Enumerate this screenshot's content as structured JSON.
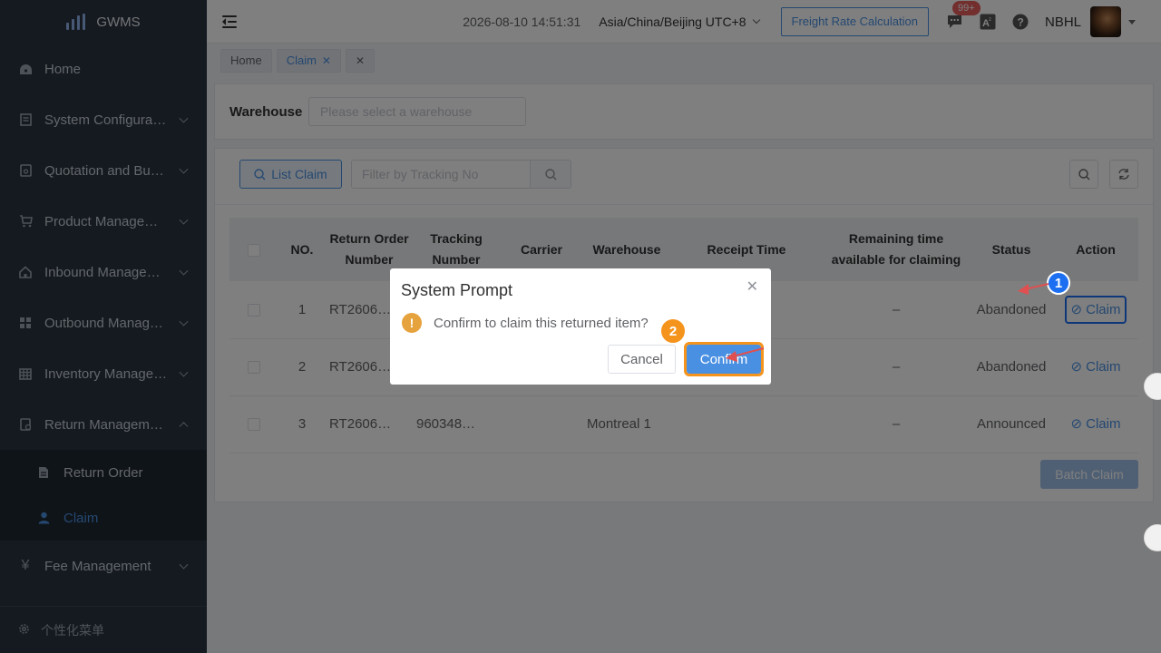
{
  "app": {
    "name": "GWMS"
  },
  "sidebar": {
    "items": [
      {
        "label": "Home",
        "icon": "dashboard-icon"
      },
      {
        "label": "System Configuration",
        "icon": "document-icon"
      },
      {
        "label": "Quotation and Business",
        "icon": "quote-icon"
      },
      {
        "label": "Product Management",
        "icon": "cart-icon"
      },
      {
        "label": "Inbound Management",
        "icon": "home-icon"
      },
      {
        "label": "Outbound Management",
        "icon": "grid-icon"
      },
      {
        "label": "Inventory Management",
        "icon": "table-icon"
      },
      {
        "label": "Return Management",
        "icon": "return-icon"
      },
      {
        "label": "Fee Management",
        "icon": "yen-icon"
      }
    ],
    "sub_items": [
      {
        "label": "Return Order",
        "icon": "file-icon"
      },
      {
        "label": "Claim",
        "icon": "user-icon"
      }
    ],
    "footer": "个性化菜单"
  },
  "header": {
    "datetime": "2026-08-10 14:51:31",
    "timezone": "Asia/China/Beijing UTC+8",
    "freight_button": "Freight Rate Calculation",
    "badge": "99+",
    "user": "NBHL"
  },
  "tabs": [
    {
      "label": "Home"
    },
    {
      "label": "Claim"
    }
  ],
  "filters": {
    "warehouse_label": "Warehouse",
    "warehouse_placeholder": "Please select a warehouse",
    "list_button": "List Claim",
    "tracking_placeholder": "Filter by Tracking No"
  },
  "table": {
    "headers": [
      "NO.",
      "Return Order Number",
      "Tracking Number",
      "Carrier",
      "Warehouse",
      "Receipt Time",
      "Remaining time available for claiming",
      "Status",
      "Action"
    ],
    "rows": [
      {
        "no": "1",
        "return_order": "RT2606…",
        "tracking": "",
        "carrier": "",
        "warehouse": "",
        "receipt": "",
        "remaining": "–",
        "status": "Abandoned",
        "action": "Claim"
      },
      {
        "no": "2",
        "return_order": "RT2606…",
        "tracking": "",
        "carrier": "",
        "warehouse": "",
        "receipt": "",
        "remaining": "–",
        "status": "Abandoned",
        "action": "Claim"
      },
      {
        "no": "3",
        "return_order": "RT2606…",
        "tracking": "960348…",
        "carrier": "",
        "warehouse": "Montreal 1",
        "receipt": "",
        "remaining": "–",
        "status": "Announced",
        "action": "Claim"
      }
    ],
    "batch_button": "Batch Claim"
  },
  "dialog": {
    "title": "System Prompt",
    "message": "Confirm to claim this returned item?",
    "cancel": "Cancel",
    "confirm": "Confirm"
  },
  "annotations": {
    "step1": "1",
    "step2": "2"
  },
  "colors": {
    "sidebar": "#2b3543",
    "primary": "#4a90e2",
    "step1": "#1d6ff2",
    "step2": "#f5941d",
    "warning": "#e6a23c",
    "badge": "#e65d5d"
  }
}
